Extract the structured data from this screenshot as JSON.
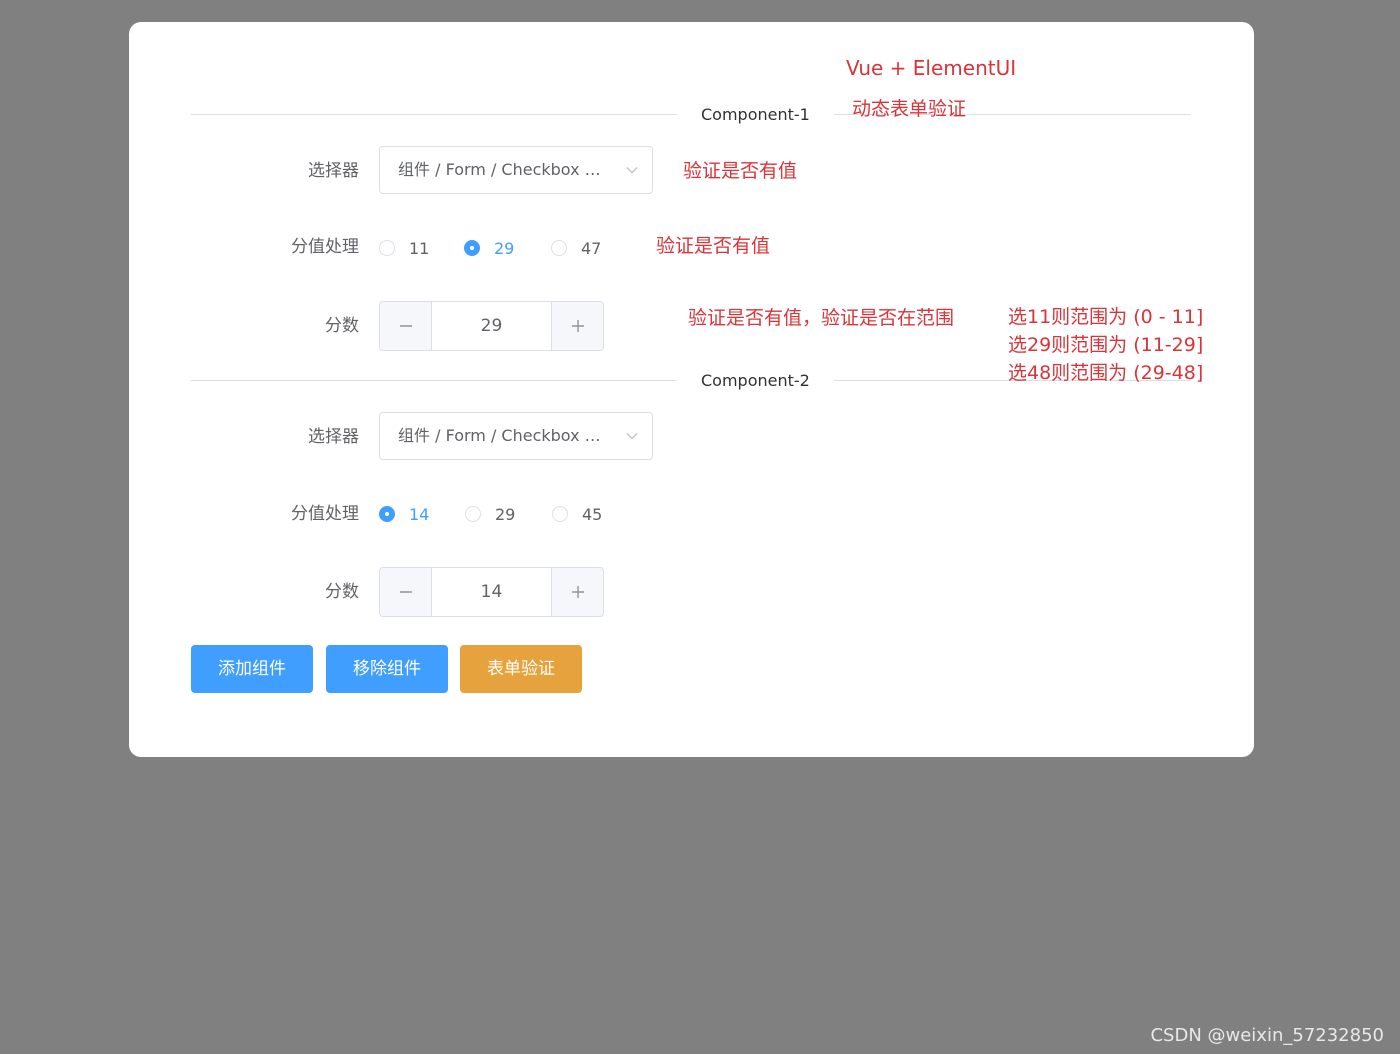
{
  "annotations": {
    "title": "Vue + ElementUI",
    "subtitle": "动态表单验证",
    "select_note": "验证是否有值",
    "radio_note": "验证是否有值",
    "score_note": "验证是否有值，验证是否在范围",
    "range_notes": [
      "选11则范围为 (0 - 11]",
      "选29则范围为 (11-29]",
      "选48则范围为 (29-48]"
    ]
  },
  "labels": {
    "selector": "选择器",
    "score_handling": "分值处理",
    "score": "分数"
  },
  "components": [
    {
      "title": "Component-1",
      "select_value": "组件 / Form / Checkbox 多选框",
      "radios": [
        "11",
        "29",
        "47"
      ],
      "selected_radio": "29",
      "score": "29"
    },
    {
      "title": "Component-2",
      "select_value": "组件 / Form / Checkbox 多选框",
      "radios": [
        "14",
        "29",
        "45"
      ],
      "selected_radio": "14",
      "score": "14"
    }
  ],
  "buttons": {
    "add": "添加组件",
    "remove": "移除组件",
    "validate": "表单验证"
  },
  "colors": {
    "primary": "#409eff",
    "warning": "#e6a23c",
    "annotation": "#d9343a"
  },
  "watermark": "CSDN @weixin_57232850"
}
